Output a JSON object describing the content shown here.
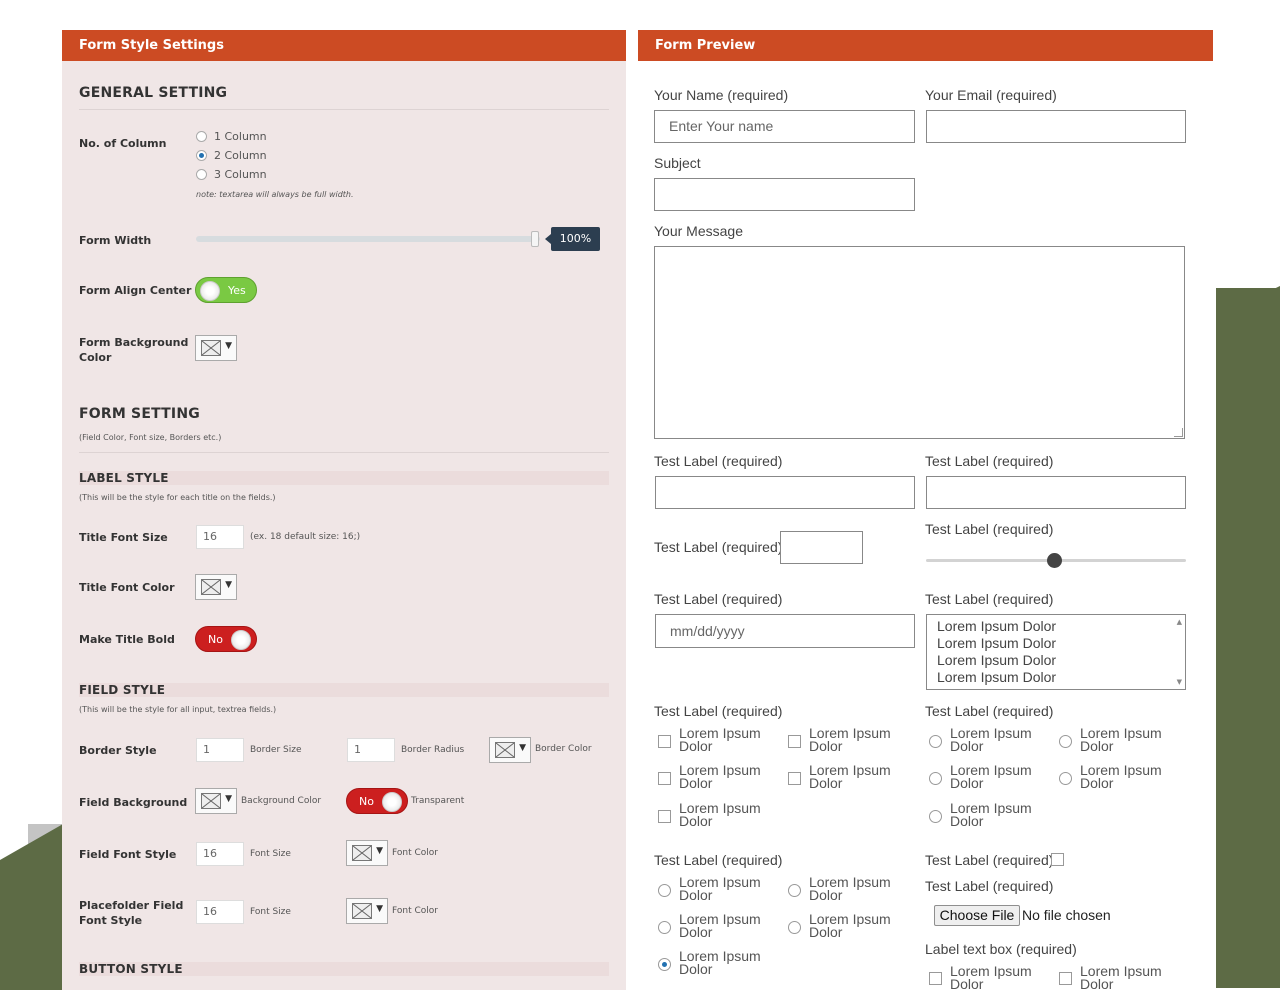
{
  "left_panel": {
    "title": "Form Style Settings",
    "general": {
      "heading": "GENERAL SETTING",
      "columns_label": "No. of Column",
      "column_options": [
        "1 Column",
        "2 Column",
        "3 Column"
      ],
      "column_selected": "2 Column",
      "column_note": "note: textarea will always be full width.",
      "form_width_label": "Form Width",
      "form_width_value": "100%",
      "form_width_level": 1.0,
      "align_center_label": "Form Align Center",
      "align_center_toggle": "Yes",
      "bg_color_label": "Form Background Color"
    },
    "form_setting": {
      "heading": "FORM SETTING",
      "subtitle": "(Field Color, Font size, Borders etc.)"
    },
    "label_style": {
      "heading": "LABEL STYLE",
      "subtitle": "(This will be the style for each title on the fields.)",
      "title_font_size_label": "Title Font Size",
      "title_font_size_value": "16",
      "title_font_size_hint": "(ex. 18 default size: 16;)",
      "title_font_color_label": "Title Font Color",
      "title_bold_label": "Make Title Bold",
      "title_bold_toggle": "No"
    },
    "field_style": {
      "heading": "FIELD STYLE",
      "subtitle": "(This will be the style for all input, textrea fields.)",
      "border_style_label": "Border Style",
      "border_size_value": "1",
      "border_size_text": "Border Size",
      "border_radius_value": "1",
      "border_radius_text": "Border Radius",
      "border_color_text": "Border Color",
      "field_bg_label": "Field Background",
      "bg_color_text": "Background Color",
      "transparent_toggle": "No",
      "transparent_text": "Transparent",
      "field_font_label": "Field Font Style",
      "field_font_size_value": "16",
      "font_size_text": "Font Size",
      "font_color_text": "Font Color",
      "placeholder_label": "Placefolder Field Font Style",
      "placeholder_font_size_value": "16",
      "placeholder_font_size_text": "Font Size",
      "placeholder_font_color_text": "Font Color"
    },
    "button_style": {
      "heading": "BUTTON STYLE"
    }
  },
  "right_panel": {
    "title": "Form Preview",
    "name_label": "Your Name (required)",
    "name_placeholder": "Enter Your name",
    "email_label": "Your Email (required)",
    "subject_label": "Subject",
    "message_label": "Your Message",
    "test_label": "Test Label (required)",
    "date_placeholder": "mm/dd/yyyy",
    "list_items": [
      "Lorem Ipsum Dolor",
      "Lorem Ipsum Dolor",
      "Lorem Ipsum Dolor",
      "Lorem Ipsum Dolor"
    ],
    "option_line1": "Lorem Ipsum",
    "option_line2": "Dolor",
    "range_value_fraction": 0.5,
    "choose_file": "Choose File",
    "no_file": "No file chosen",
    "textbox_label": "Label text box (required)"
  },
  "colors": {
    "header_bg": "#cc4b23",
    "panel_bg": "#f0e6e6",
    "toggle_yes": "#7ac943",
    "toggle_no": "#cc1f1f",
    "slider_tip": "#2c3e50",
    "bg_shape": "#5d6b45"
  },
  "icons": {
    "color_swatch": "empty-color-swatch-icon",
    "dropdown": "caret-down-icon"
  }
}
